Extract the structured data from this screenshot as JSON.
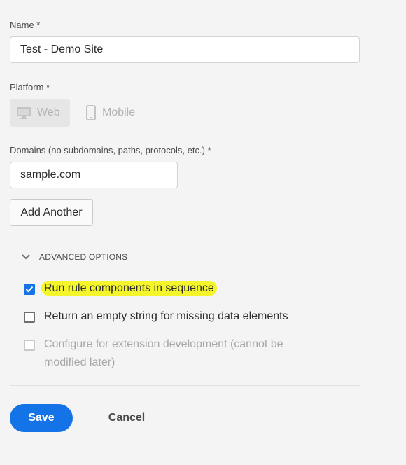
{
  "form": {
    "name_label": "Name *",
    "name_value": "Test - Demo Site",
    "platform_label": "Platform *",
    "platforms": [
      {
        "label": "Web",
        "icon": "desktop-icon",
        "selected": true
      },
      {
        "label": "Mobile",
        "icon": "mobile-phone-icon",
        "selected": false
      }
    ],
    "domains_label": "Domains (no subdomains, paths, protocols, etc.) *",
    "domain_value": "sample.com",
    "add_another_label": "Add Another"
  },
  "advanced": {
    "toggle_label": "ADVANCED OPTIONS",
    "toggle_icon": "chevron-down-icon",
    "options": [
      {
        "label": "Run rule components in sequence",
        "checked": true,
        "disabled": false,
        "highlighted": true
      },
      {
        "label": "Return an empty string for missing data elements",
        "checked": false,
        "disabled": false,
        "highlighted": false
      },
      {
        "label": "Configure for extension development (cannot be modified later)",
        "checked": false,
        "disabled": true,
        "highlighted": false
      }
    ]
  },
  "actions": {
    "save_label": "Save",
    "cancel_label": "Cancel"
  },
  "colors": {
    "accent": "#1473e6",
    "highlight": "#f5f52b",
    "background": "#f4f4f4"
  }
}
